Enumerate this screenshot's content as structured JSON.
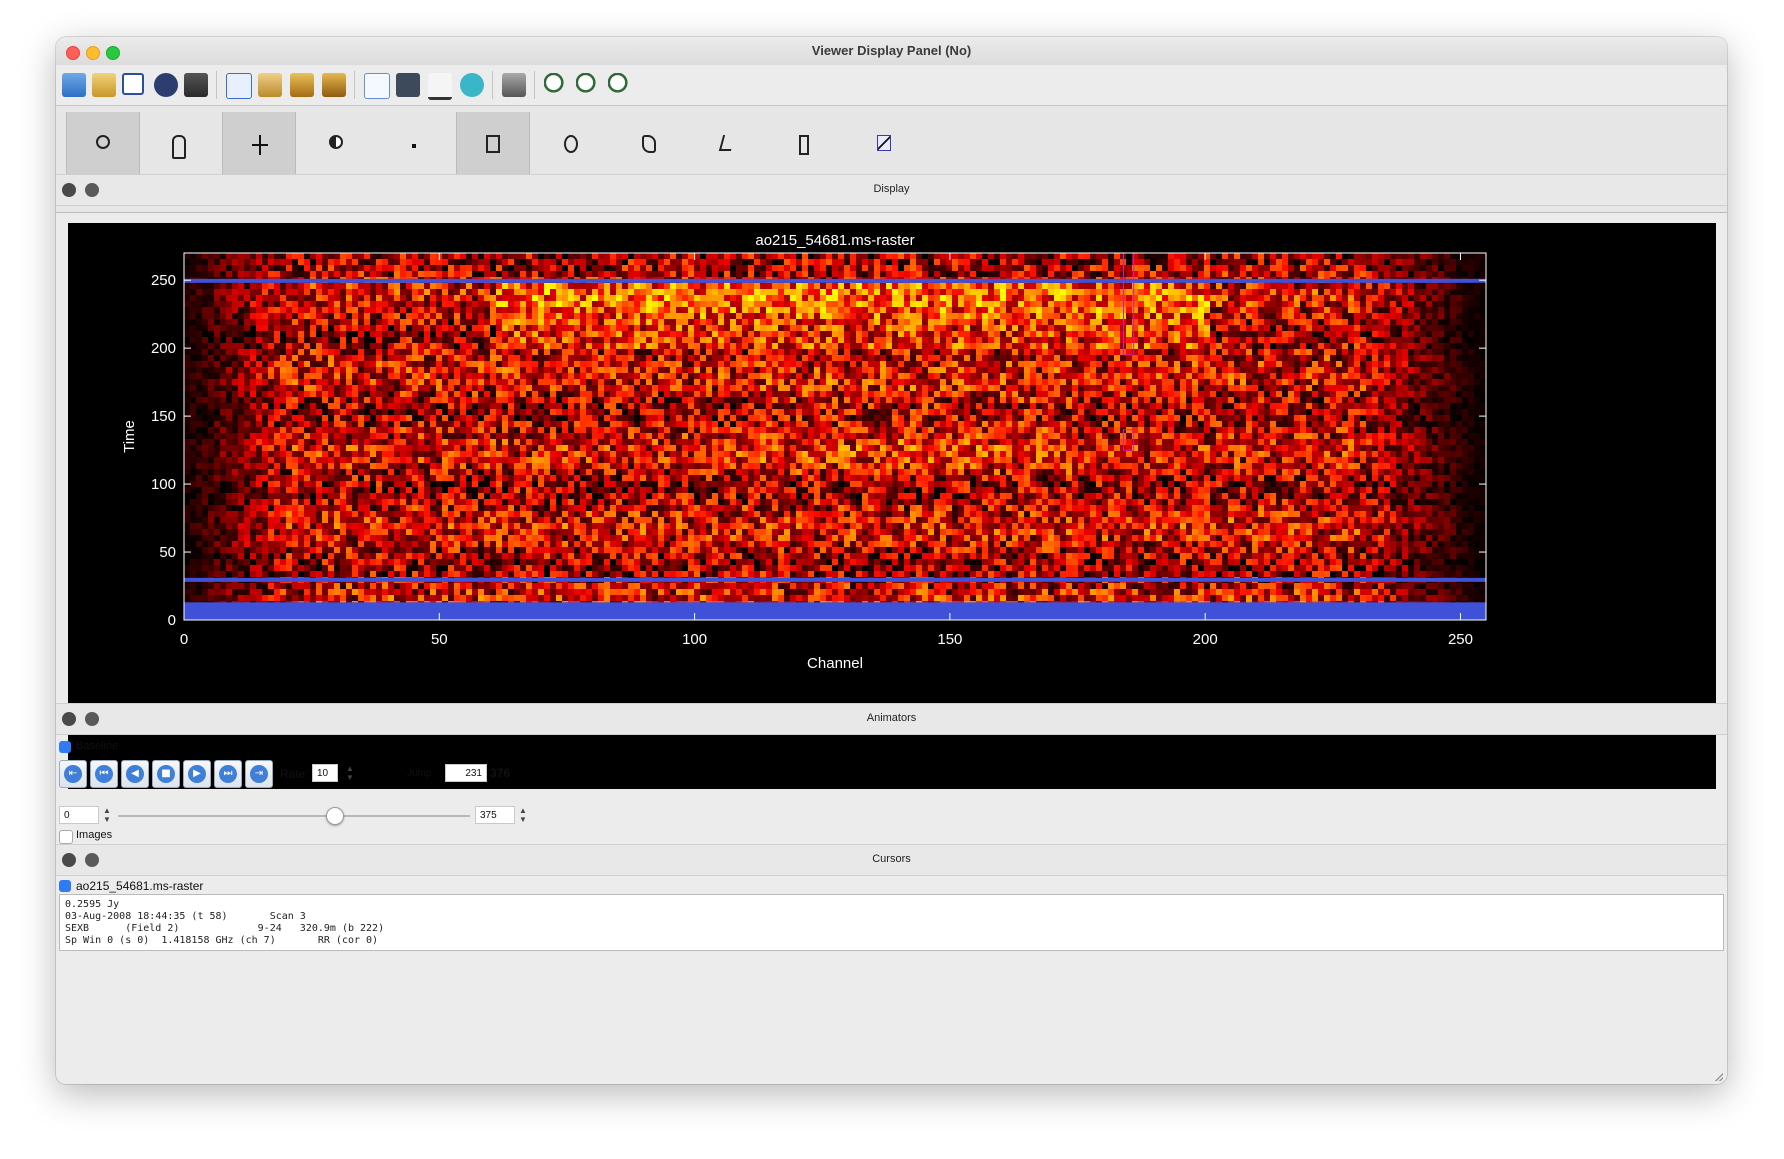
{
  "window": {
    "title": "Viewer Display Panel (No)"
  },
  "toolbar": {
    "icons": [
      "open-folder-icon",
      "wrench-icon",
      "copy-panel-icon",
      "close-panel-icon",
      "save-icon",
      "new-window-icon",
      "tools-icon",
      "image-export-icon",
      "movie-icon",
      "plot-icon",
      "fit-icon",
      "histogram-icon",
      "region-icon",
      "print-icon",
      "zoom-fit-icon",
      "zoom-in-icon",
      "zoom-out-icon"
    ],
    "mouse_tools": [
      "zoom-tool-icon",
      "pan-tool-icon",
      "crosshair-tool-icon",
      "contrast-tool-icon",
      "point-tool-icon",
      "rectangle-region-tool-icon",
      "ellipse-region-tool-icon",
      "polygon-region-tool-icon",
      "polyline-tool-icon",
      "ruler-tool-icon",
      "position-velocity-tool-icon"
    ]
  },
  "display_panel": {
    "title": "Display"
  },
  "chart_data": {
    "type": "heatmap",
    "title": "ao215_54681.ms-raster",
    "xlabel": "Channel",
    "ylabel": "Time",
    "xlim": [
      0,
      255
    ],
    "ylim": [
      0,
      270
    ],
    "xticks": [
      0,
      50,
      100,
      150,
      200,
      250
    ],
    "yticks": [
      0,
      50,
      100,
      150,
      200,
      250
    ],
    "colormap": "hot",
    "flagged_color": "#3f51d6",
    "flagged_time_ranges": [
      [
        0,
        13
      ],
      [
        29,
        31
      ],
      [
        249,
        251
      ]
    ],
    "edge_falloff_channels": [
      [
        0,
        20
      ],
      [
        230,
        255
      ]
    ],
    "bright_region": {
      "channels": [
        60,
        200
      ],
      "times": [
        200,
        250
      ]
    },
    "region_markers": [
      {
        "channels": [
          184,
          186
        ],
        "times": [
          195,
          270
        ],
        "color": "#c020c0"
      },
      {
        "channels": [
          184,
          186
        ],
        "times": [
          125,
          140
        ],
        "color": "#c020c0"
      }
    ]
  },
  "animators": {
    "title": "Animators",
    "baseline_label": "Baseline",
    "baseline_checked": true,
    "rate_label": "Rate:",
    "rate_value": "10",
    "jump_label": "Jump",
    "jump_value": "231",
    "total_frames": "376",
    "slider_min": "0",
    "slider_max": "375",
    "slider_position": 0.615,
    "images_label": "Images",
    "images_checked": false,
    "buttons": [
      "rewind-to-start-icon",
      "step-back-icon",
      "play-backward-icon",
      "stop-icon",
      "play-forward-icon",
      "step-forward-icon",
      "go-to-end-icon"
    ]
  },
  "cursors": {
    "title": "Cursors",
    "item_label": "ao215_54681.ms-raster",
    "item_checked": true,
    "lines": [
      "0.2595 Jy",
      "03-Aug-2008 18:44:35 (t 58)       Scan 3",
      "SEXB      (Field 2)             9-24   320.9m (b 222)",
      "Sp Win 0 (s 0)  1.418158 GHz (ch 7)       RR (cor 0)"
    ]
  }
}
